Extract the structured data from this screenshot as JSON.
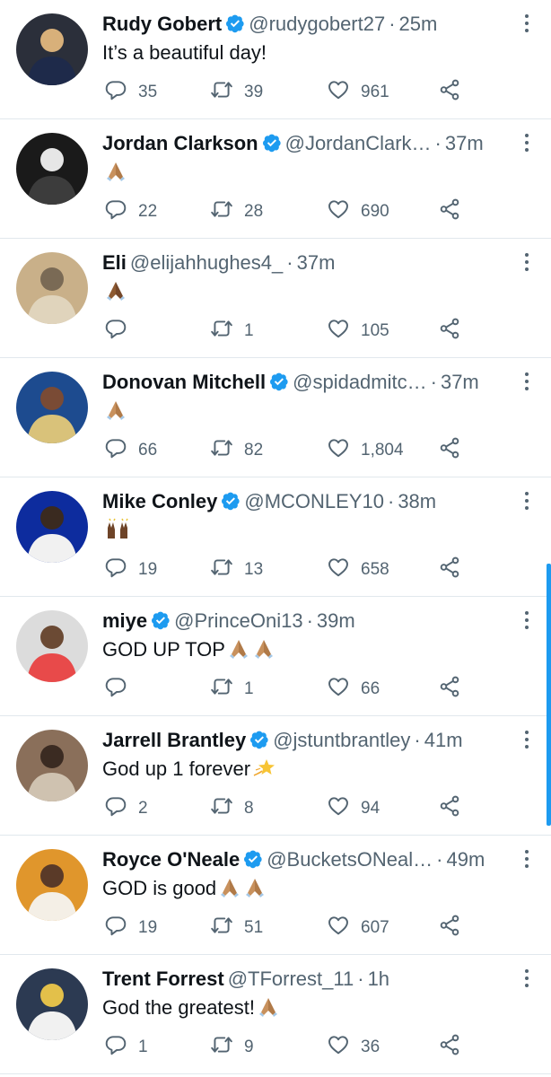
{
  "colors": {
    "accent": "#1d9bf0",
    "secondary_text": "#536471",
    "divider": "#e1e8ed"
  },
  "icons": {
    "reply": "reply-icon",
    "retweet": "retweet-icon",
    "like": "heart-icon",
    "share": "share-icon",
    "verified": "verified-badge-icon",
    "more": "more-options-icon"
  },
  "tweets": [
    {
      "name": "Rudy Gobert",
      "verified": true,
      "handle": "@rudygobert27",
      "time": "25m",
      "text": "It’s a beautiful day!",
      "emojis": [],
      "replies": "35",
      "retweets": "39",
      "likes": "961"
    },
    {
      "name": "Jordan Clarkson",
      "verified": true,
      "handle": "@JordanClark…",
      "time": "37m",
      "text": "",
      "emojis": [
        "folded-hands"
      ],
      "replies": "22",
      "retweets": "28",
      "likes": "690"
    },
    {
      "name": "Eli",
      "verified": false,
      "handle": "@elijahhughes4_",
      "time": "37m",
      "text": "",
      "emojis": [
        "folded-hands-dark"
      ],
      "replies": "",
      "retweets": "1",
      "likes": "105"
    },
    {
      "name": "Donovan Mitchell",
      "verified": true,
      "handle": "@spidadmitc…",
      "time": "37m",
      "text": "",
      "emojis": [
        "folded-hands"
      ],
      "replies": "66",
      "retweets": "82",
      "likes": "1,804"
    },
    {
      "name": "Mike Conley",
      "verified": true,
      "handle": "@MCONLEY10",
      "time": "38m",
      "text": "",
      "emojis": [
        "raising-hands"
      ],
      "replies": "19",
      "retweets": "13",
      "likes": "658"
    },
    {
      "name": "miye",
      "verified": true,
      "handle": "@PrinceOni13",
      "time": "39m",
      "text": "GOD UP TOP",
      "emojis": [
        "folded-hands",
        "folded-hands"
      ],
      "replies": "",
      "retweets": "1",
      "likes": "66"
    },
    {
      "name": "Jarrell Brantley",
      "verified": true,
      "handle": "@jstuntbrantley",
      "time": "41m",
      "text": "God up 1 forever",
      "emojis": [
        "dizzy-star"
      ],
      "replies": "2",
      "retweets": "8",
      "likes": "94"
    },
    {
      "name": "Royce O'Neale",
      "verified": true,
      "handle": "@BucketsONeal…",
      "time": "49m",
      "text": "GOD is good",
      "emojis": [
        "folded-hands",
        "folded-hands"
      ],
      "replies": "19",
      "retweets": "51",
      "likes": "607"
    },
    {
      "name": "Trent Forrest",
      "verified": false,
      "handle": "@TForrest_11",
      "time": "1h",
      "text": "God the greatest!",
      "emojis": [
        "folded-hands"
      ],
      "replies": "1",
      "retweets": "9",
      "likes": "36"
    }
  ]
}
